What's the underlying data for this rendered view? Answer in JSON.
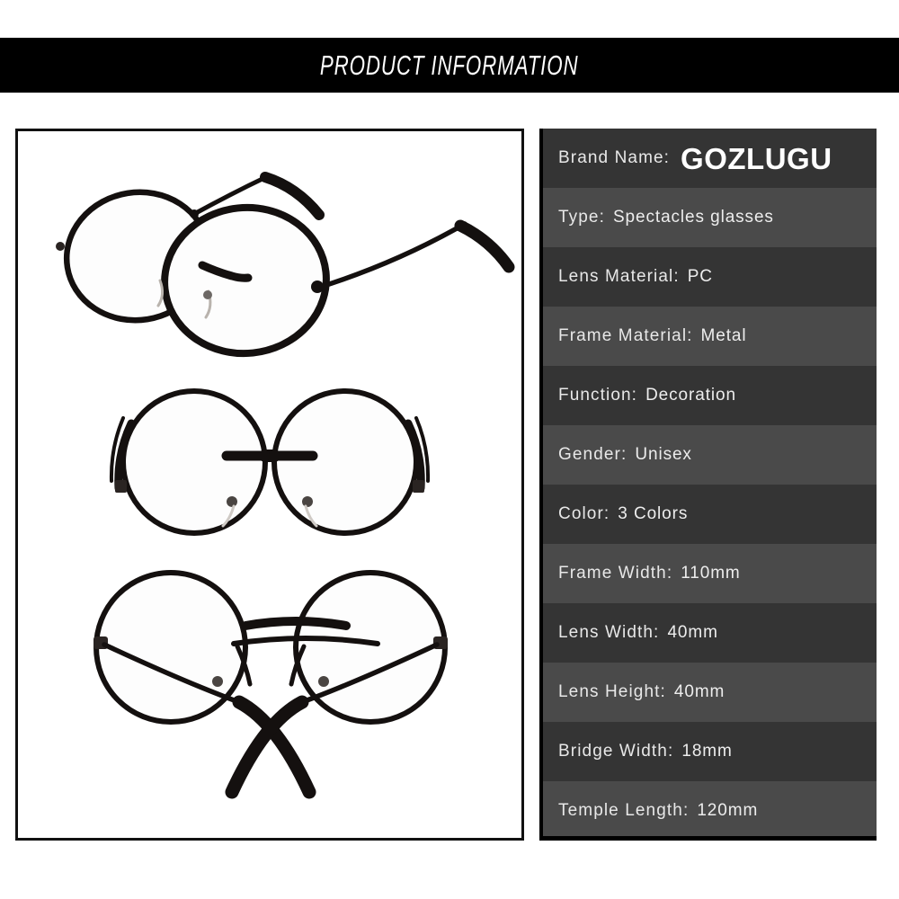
{
  "header": {
    "title": "PRODUCT INFORMATION",
    "background_color": "#000000",
    "text_color": "#ffffff"
  },
  "gallery": {
    "photos": [
      {
        "name": "glasses-angled-view",
        "alt": "Round black metal eyeglasses, three-quarter angled view with temples extended"
      },
      {
        "name": "glasses-front-view",
        "alt": "Round black metal eyeglasses, front view with folded temples"
      },
      {
        "name": "glasses-rear-view",
        "alt": "Round black metal eyeglasses, rear view with temples crossed"
      }
    ]
  },
  "spec_panel": {
    "row_colors": {
      "dark": "#343434",
      "light": "#4a4a4a"
    },
    "rows": [
      {
        "label": "Brand  Name:",
        "value": "GOZLUGU",
        "brand": true,
        "stripe": "dark"
      },
      {
        "label": "Type:",
        "value": "Spectacles  glasses",
        "brand": false,
        "stripe": "light"
      },
      {
        "label": "Lens  Material:",
        "value": "PC",
        "brand": false,
        "stripe": "dark"
      },
      {
        "label": "Frame  Material:",
        "value": "Metal",
        "brand": false,
        "stripe": "light"
      },
      {
        "label": "Function:",
        "value": "Decoration",
        "brand": false,
        "stripe": "dark"
      },
      {
        "label": "Gender:",
        "value": "Unisex",
        "brand": false,
        "stripe": "light"
      },
      {
        "label": "Color:",
        "value": "3  Colors",
        "brand": false,
        "stripe": "dark"
      },
      {
        "label": "Frame  Width:",
        "value": "110mm",
        "brand": false,
        "stripe": "light"
      },
      {
        "label": "Lens Width:",
        "value": "40mm",
        "brand": false,
        "stripe": "dark"
      },
      {
        "label": "Lens  Height:",
        "value": "40mm",
        "brand": false,
        "stripe": "light"
      },
      {
        "label": "Bridge  Width:",
        "value": "18mm",
        "brand": false,
        "stripe": "dark"
      },
      {
        "label": "Temple  Length:",
        "value": "120mm",
        "brand": false,
        "stripe": "light"
      }
    ]
  }
}
